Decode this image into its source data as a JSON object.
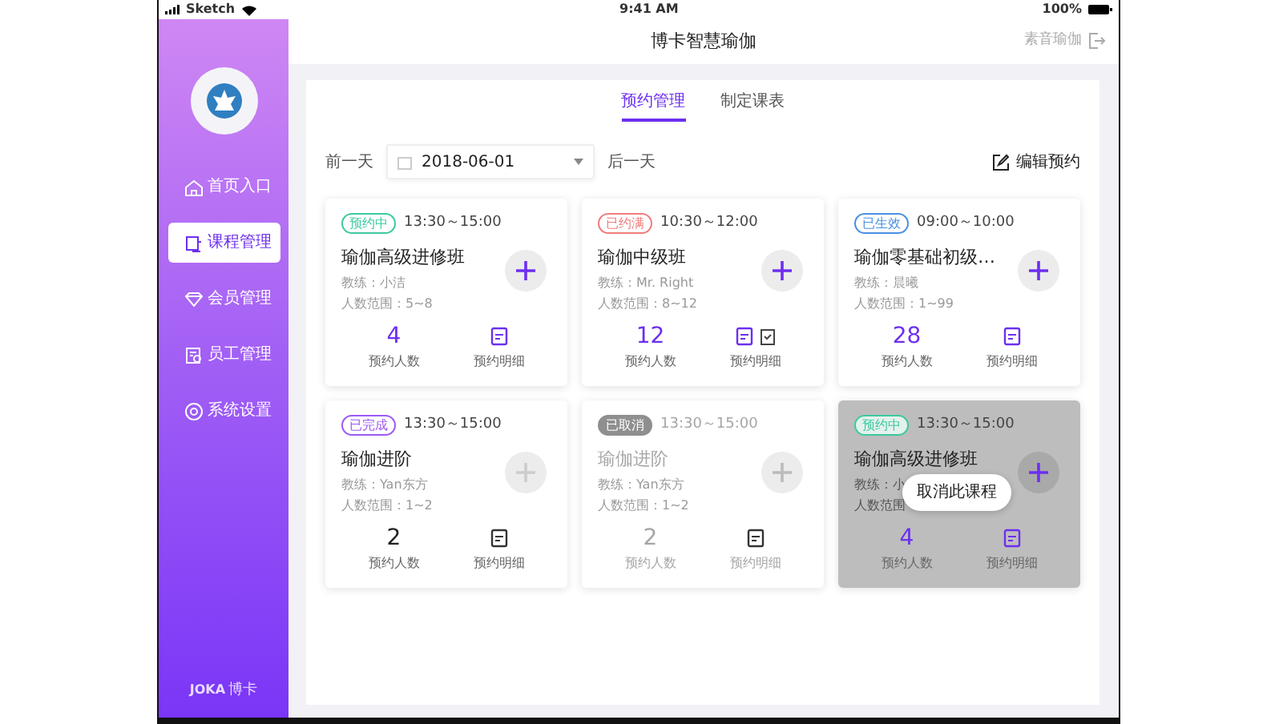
{
  "status_bar": {
    "carrier": "Sketch",
    "time": "9:41 AM",
    "battery": "100%"
  },
  "sidebar": {
    "items": [
      {
        "label": "首页入口",
        "selected": false
      },
      {
        "label": "课程管理",
        "selected": true
      },
      {
        "label": "会员管理",
        "selected": false
      },
      {
        "label": "员工管理",
        "selected": false
      },
      {
        "label": "系统设置",
        "selected": false
      }
    ],
    "footer_brand": "JOKA",
    "footer_name": "博卡"
  },
  "header": {
    "title": "博卡智慧瑜伽",
    "user": "素音瑜伽"
  },
  "tabs": [
    {
      "label": "预约管理",
      "selected": true
    },
    {
      "label": "制定课表",
      "selected": false
    }
  ],
  "date_nav": {
    "prev": "前一天",
    "date": "2018-06-01",
    "next": "后一天"
  },
  "edit_button": "编辑预约",
  "cards": [
    {
      "kind": "normal",
      "status": "预约中",
      "color": "#3cc9a0",
      "time": "13:30～15:00",
      "title": "瑜伽高级进修班",
      "coach": "教练：小洁",
      "range": "人数范围：5~8",
      "count": "4",
      "count_highlighted": true,
      "count_label": "预约人数",
      "detail_label": "预约明细",
      "extra_icon": false
    },
    {
      "kind": "normal",
      "status": "已约满",
      "color": "#f07c7c",
      "time": "10:30～12:00",
      "title": "瑜伽中级班",
      "coach": "教练：Mr. Right",
      "range": "人数范围：8~12",
      "count": "12",
      "count_highlighted": true,
      "count_label": "预约人数",
      "detail_label": "预约明细",
      "extra_icon": true
    },
    {
      "kind": "normal",
      "status": "已生效",
      "color": "#4a90e2",
      "time": "09:00～10:00",
      "title": "瑜伽零基础初级…",
      "coach": "教练：晨曦",
      "range": "人数范围：1~99",
      "count": "28",
      "count_highlighted": true,
      "count_label": "预约人数",
      "detail_label": "预约明细",
      "extra_icon": false
    },
    {
      "kind": "normal",
      "status": "已完成",
      "color": "#9b59f5",
      "time": "13:30～15:00",
      "title": "瑜伽进阶",
      "coach": "教练：Yan东方",
      "range": "人数范围：1~2",
      "count": "2",
      "count_highlighted": false,
      "count_label": "预约人数",
      "detail_label": "预约明细",
      "extra_icon": false
    },
    {
      "kind": "disabled",
      "status": "已取消",
      "color": "#8f8f8f",
      "time": "13:30～15:00",
      "title": "瑜伽进阶",
      "coach": "教练：Yan东方",
      "range": "人数范围：1~2",
      "count": "2",
      "count_highlighted": false,
      "count_label": "预约人数",
      "detail_label": "预约明细",
      "extra_icon": false
    },
    {
      "kind": "overlay",
      "status": "预约中",
      "color": "#3cc9a0",
      "time": "13:30～15:00",
      "title": "瑜伽高级进修班",
      "coach": "教练：小",
      "range": "人数范围",
      "count": "4",
      "count_highlighted": true,
      "count_label": "预约人数",
      "detail_label": "预约明细",
      "extra_icon": false,
      "overlay_label": "取消此课程"
    }
  ]
}
